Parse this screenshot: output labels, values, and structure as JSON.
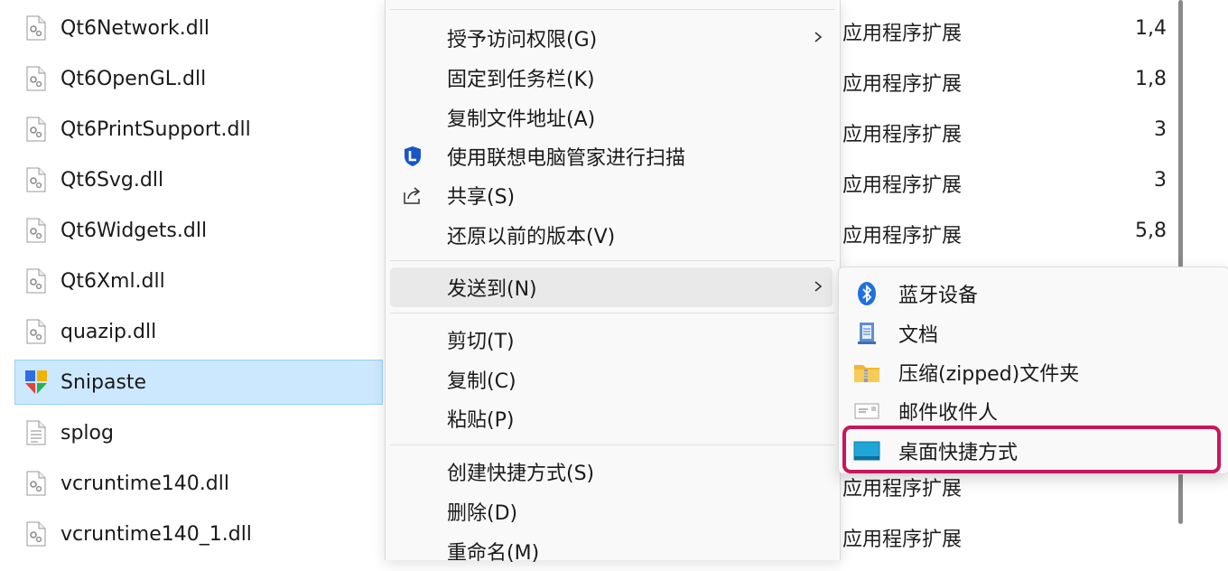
{
  "files": [
    {
      "name": "Qt6Network.dll",
      "icon": "dll-file-icon"
    },
    {
      "name": "Qt6OpenGL.dll",
      "icon": "dll-file-icon"
    },
    {
      "name": "Qt6PrintSupport.dll",
      "icon": "dll-file-icon"
    },
    {
      "name": "Qt6Svg.dll",
      "icon": "dll-file-icon"
    },
    {
      "name": "Qt6Widgets.dll",
      "icon": "dll-file-icon"
    },
    {
      "name": "Qt6Xml.dll",
      "icon": "dll-file-icon"
    },
    {
      "name": "quazip.dll",
      "icon": "dll-file-icon"
    },
    {
      "name": "Snipaste",
      "icon": "snipaste-app-icon",
      "selected": true
    },
    {
      "name": "splog",
      "icon": "text-file-icon"
    },
    {
      "name": "vcruntime140.dll",
      "icon": "dll-file-icon"
    },
    {
      "name": "vcruntime140_1.dll",
      "icon": "dll-file-icon"
    }
  ],
  "details": {
    "types": [
      "应用程序扩展",
      "应用程序扩展",
      "应用程序扩展",
      "应用程序扩展",
      "应用程序扩展",
      "应用程序扩展",
      "应用程序扩展"
    ],
    "sizes": [
      "1,4",
      "1,8",
      "3",
      "3",
      "5,8"
    ]
  },
  "context_menu": {
    "items": [
      {
        "label": "授予访问权限(G)",
        "has_submenu": true
      },
      {
        "label": "固定到任务栏(K)"
      },
      {
        "label": "复制文件地址(A)"
      },
      {
        "label": "使用联想电脑管家进行扫描",
        "icon": "lenovo-shield-icon"
      },
      {
        "label": "共享(S)",
        "icon": "share-icon"
      },
      {
        "label": "还原以前的版本(V)"
      },
      {
        "label": "发送到(N)",
        "has_submenu": true,
        "hover": true
      },
      {
        "label": "剪切(T)"
      },
      {
        "label": "复制(C)"
      },
      {
        "label": "粘贴(P)"
      },
      {
        "label": "创建快捷方式(S)"
      },
      {
        "label": "删除(D)"
      },
      {
        "label": "重命名(M)"
      }
    ]
  },
  "send_to_submenu": {
    "items": [
      {
        "label": "蓝牙设备",
        "icon": "bluetooth-icon"
      },
      {
        "label": "文档",
        "icon": "documents-icon"
      },
      {
        "label": "压缩(zipped)文件夹",
        "icon": "zip-folder-icon"
      },
      {
        "label": "邮件收件人",
        "icon": "mail-recipient-icon"
      },
      {
        "label": "桌面快捷方式",
        "icon": "desktop-shortcut-icon",
        "highlighted": true
      }
    ]
  },
  "colors": {
    "selection": "#cce8ff",
    "highlight_border": "#c8165b",
    "menu_background": "#f9f9f9"
  }
}
